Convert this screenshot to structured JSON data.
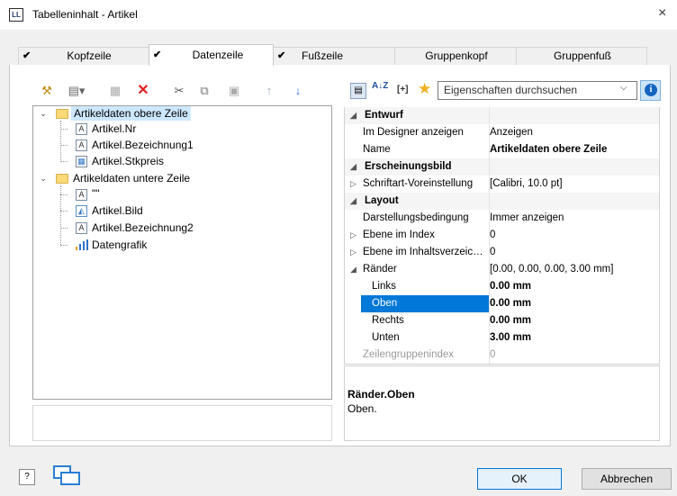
{
  "window": {
    "title": "Tabelleninhalt - Artikel",
    "app_icon": "LL",
    "close": "×"
  },
  "tabs": [
    {
      "label": "Kopfzeile",
      "checked": true
    },
    {
      "label": "Datenzeile",
      "checked": true,
      "active": true
    },
    {
      "label": "Fußzeile",
      "checked": true
    },
    {
      "label": "Gruppenkopf",
      "checked": false
    },
    {
      "label": "Gruppenfuß",
      "checked": false
    }
  ],
  "tree": {
    "items": [
      {
        "label": "Artikeldaten obere Zeile",
        "kind": "folder",
        "expanded": true,
        "selected": true
      },
      {
        "label": "Artikel.Nr",
        "kind": "text"
      },
      {
        "label": "Artikel.Bezeichnung1",
        "kind": "text"
      },
      {
        "label": "Artikel.Stkpreis",
        "kind": "table"
      },
      {
        "label": "Artikeldaten untere Zeile",
        "kind": "folder",
        "expanded": true
      },
      {
        "label": "\"\"",
        "kind": "text"
      },
      {
        "label": "Artikel.Bild",
        "kind": "image"
      },
      {
        "label": "Artikel.Bezeichnung2",
        "kind": "text"
      },
      {
        "label": "Datengrafik",
        "kind": "chart"
      }
    ]
  },
  "properties": {
    "search_placeholder": "Eigenschaften durchsuchen",
    "sort_az": "A↓Z",
    "brackets": "[+]",
    "rows": [
      {
        "type": "cat",
        "label": "Entwurf"
      },
      {
        "type": "prop",
        "label": "Im Designer anzeigen",
        "value": "Anzeigen"
      },
      {
        "type": "prop",
        "label": "Name",
        "value": "Artikeldaten obere Zeile",
        "bold": true
      },
      {
        "type": "cat",
        "label": "Erscheinungsbild"
      },
      {
        "type": "prop",
        "label": "Schriftart-Voreinstellung",
        "value": "[Calibri, 10.0 pt]",
        "expander": "▷"
      },
      {
        "type": "cat",
        "label": "Layout"
      },
      {
        "type": "prop",
        "label": "Darstellungsbedingung",
        "value": "Immer anzeigen"
      },
      {
        "type": "prop",
        "label": "Ebene im Index",
        "value": "0",
        "expander": "▷"
      },
      {
        "type": "prop",
        "label": "Ebene im Inhaltsverzeic…",
        "value": "0",
        "expander": "▷"
      },
      {
        "type": "prop",
        "label": "Ränder",
        "value": "[0.00, 0.00, 0.00, 3.00 mm]",
        "expander": "◢"
      },
      {
        "type": "sub",
        "label": "Links",
        "value": "0.00 mm",
        "bold": true
      },
      {
        "type": "sub",
        "label": "Oben",
        "value": "0.00 mm",
        "bold": true,
        "selected": true
      },
      {
        "type": "sub",
        "label": "Rechts",
        "value": "0.00 mm",
        "bold": true
      },
      {
        "type": "sub",
        "label": "Unten",
        "value": "3.00 mm",
        "bold": true
      },
      {
        "type": "prop",
        "label": "Zeilengruppenindex",
        "value": "0",
        "disabled": true
      }
    ],
    "description": {
      "title": "Ränder.Oben",
      "text": "Oben."
    }
  },
  "buttons": {
    "ok": "OK",
    "cancel": "Abbrechen",
    "help": "?"
  },
  "colors": {
    "accent": "#0078d7",
    "selection": "#0078d7",
    "tree_selection": "#cce8ff"
  }
}
